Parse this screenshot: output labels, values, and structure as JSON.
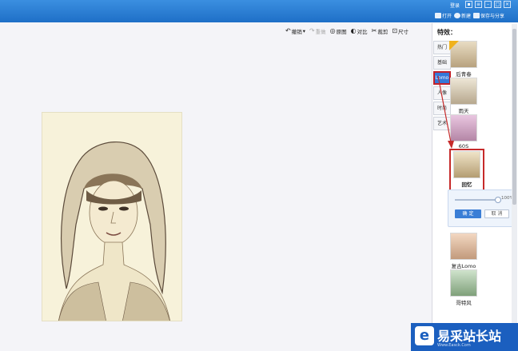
{
  "titlebar": {
    "login": "登录",
    "actions": [
      {
        "icon": "folder-icon",
        "label": "打开"
      },
      {
        "icon": "plus-circle-icon",
        "label": "新建"
      },
      {
        "icon": "save-icon",
        "label": "保存与分享"
      }
    ]
  },
  "toolbar": {
    "undo": "撤销",
    "redo": "重做",
    "original": "原图",
    "compare": "对比",
    "crop": "裁剪",
    "size": "尺寸"
  },
  "panel": {
    "title": "特效：",
    "categories": [
      "热门",
      "基础",
      "Lomo",
      "人像",
      "时尚",
      "艺术"
    ],
    "effects": [
      {
        "label": "后青春"
      },
      {
        "label": "雨天"
      },
      {
        "label": "60S"
      },
      {
        "label": "回忆"
      },
      {
        "label": "复古Lomo"
      },
      {
        "label": "哥特风"
      }
    ],
    "adjust": {
      "percent": "100%",
      "ok": "确 定",
      "cancel": "取 消",
      "level": 1.0
    }
  },
  "watermark": {
    "logo": "e",
    "title": "易采站长站",
    "subtitle": "Www.Easck.Com"
  },
  "colors": {
    "accent": "#1e6fc7",
    "highlight": "#c62a2a"
  }
}
